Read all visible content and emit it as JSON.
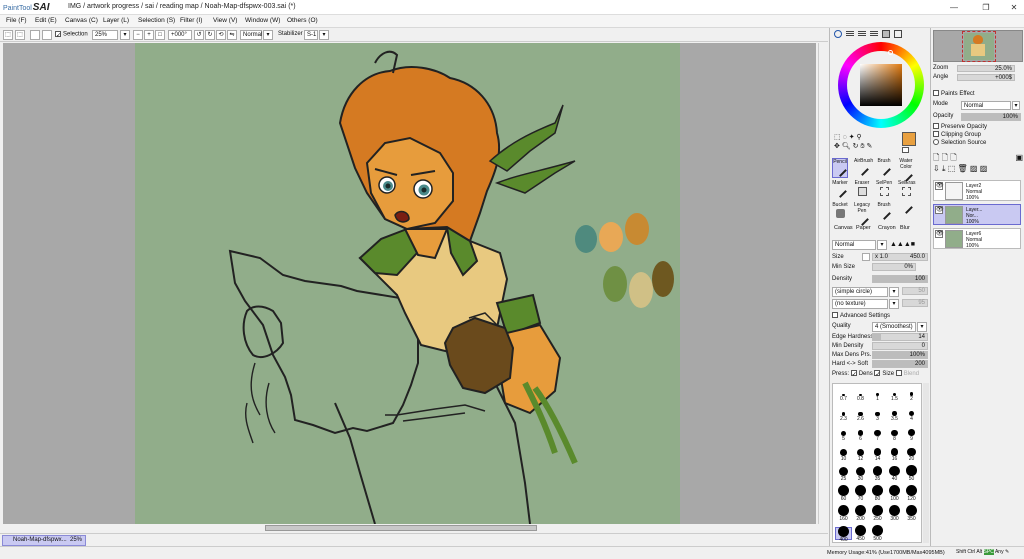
{
  "app": {
    "logo_brand": "PaintTool",
    "logo_name": "SAI",
    "window_title": "IMG / artwork progress / sai / reading map / Noah-Map-dfspwx-003.sai (*)",
    "minimize": "—",
    "maximize": "❐",
    "close": "✕"
  },
  "menu": [
    "File (F)",
    "Edit (E)",
    "Canvas (C)",
    "Layer (L)",
    "Selection (S)",
    "Filter (I)",
    "View (V)",
    "Window (W)",
    "Others (O)"
  ],
  "toolbar": {
    "selection_label": "Selection",
    "zoom_value": "25%",
    "rotation_value": "+000°",
    "blend_value": "Normal",
    "stabilizer_label": "Stabilizer",
    "stabilizer_value": "S-1"
  },
  "document": {
    "tab_label": "Noah-Map-dfspwx...",
    "tab_zoom": "25%"
  },
  "status": {
    "memory": "Memory Usage:41% (Use1700MB/Max4095MB)",
    "keys": [
      "Shift",
      "Ctrl",
      "Alt",
      "SPC",
      "Any"
    ]
  },
  "color": {
    "current_hex": "#e8a040",
    "swatch_bg": "#ffffff"
  },
  "tools": {
    "brushes_row1": [
      "Pencil",
      "AirBrush",
      "Brush",
      "Water Color"
    ],
    "brushes_row2": [
      "Marker",
      "Eraser",
      "SelPen",
      "SelEras"
    ],
    "brushes_row3": [
      "Bucket",
      "Legacy Pen",
      "Brush",
      ""
    ],
    "textures": [
      "Canvas",
      "Paper",
      "Crayon",
      "Blur"
    ]
  },
  "brush_settings": {
    "blend_mode": "Normal",
    "size_label": "Size",
    "size_mult": "x 1.0",
    "size_value": "450.0",
    "min_size_label": "Min Size",
    "min_size_value": "0%",
    "min_size_frac": 0,
    "density_label": "Density",
    "density_value": "100",
    "density_frac": 1.0,
    "shape": "(simple circle)",
    "shape_value": "50",
    "texture": "(no texture)",
    "texture_value": "95",
    "advanced_label": "Advanced Settings",
    "quality_label": "Quality",
    "quality_value": "4 (Smoothest)",
    "edge_label": "Edge Hardness",
    "edge_value": "14",
    "edge_frac": 0.14,
    "min_density_label": "Min Density",
    "min_density_value": "0",
    "min_density_frac": 0,
    "max_dens_label": "Max Dens Prs.",
    "max_dens_value": "100%",
    "max_dens_frac": 1.0,
    "hard_soft_label": "Hard <-> Soft",
    "hard_soft_value": "200",
    "hard_soft_frac": 1.0,
    "press_label": "Press:",
    "press_dens": "Dens",
    "press_size": "Size",
    "press_blend": "Blend"
  },
  "brush_sizes": [
    "0.7",
    "0.8",
    "1",
    "1.5",
    "2",
    "2.3",
    "2.6",
    "3",
    "3.5",
    "4",
    "5",
    "6",
    "7",
    "8",
    "9",
    "10",
    "12",
    "14",
    "16",
    "20",
    "25",
    "30",
    "35",
    "40",
    "50",
    "60",
    "70",
    "80",
    "100",
    "120",
    "160",
    "200",
    "250",
    "300",
    "350",
    "400",
    "450",
    "500"
  ],
  "navigator": {
    "zoom_label": "Zoom",
    "zoom_value": "25.0%",
    "angle_label": "Angle",
    "angle_value": "+000$"
  },
  "layer_props": {
    "paints_effect": "Paints Effect",
    "mode_label": "Mode",
    "mode_value": "Normal",
    "opacity_label": "Opacity",
    "opacity_value": "100%",
    "opacity_frac": 1.0,
    "preserve": "Preserve Opacity",
    "clipping": "Clipping Group",
    "sel_source": "Selection Source"
  },
  "layers": [
    {
      "name": "Layer2",
      "mode": "Normal",
      "opacity": "100%",
      "selected": false,
      "thumb": "#f4f4f4"
    },
    {
      "name": "Layer...",
      "mode": "Nor...",
      "opacity": "100%",
      "selected": true,
      "thumb": "#91ad8a"
    },
    {
      "name": "Layer6",
      "mode": "Normal",
      "opacity": "100%",
      "selected": false,
      "thumb": "#91ad8a"
    }
  ]
}
